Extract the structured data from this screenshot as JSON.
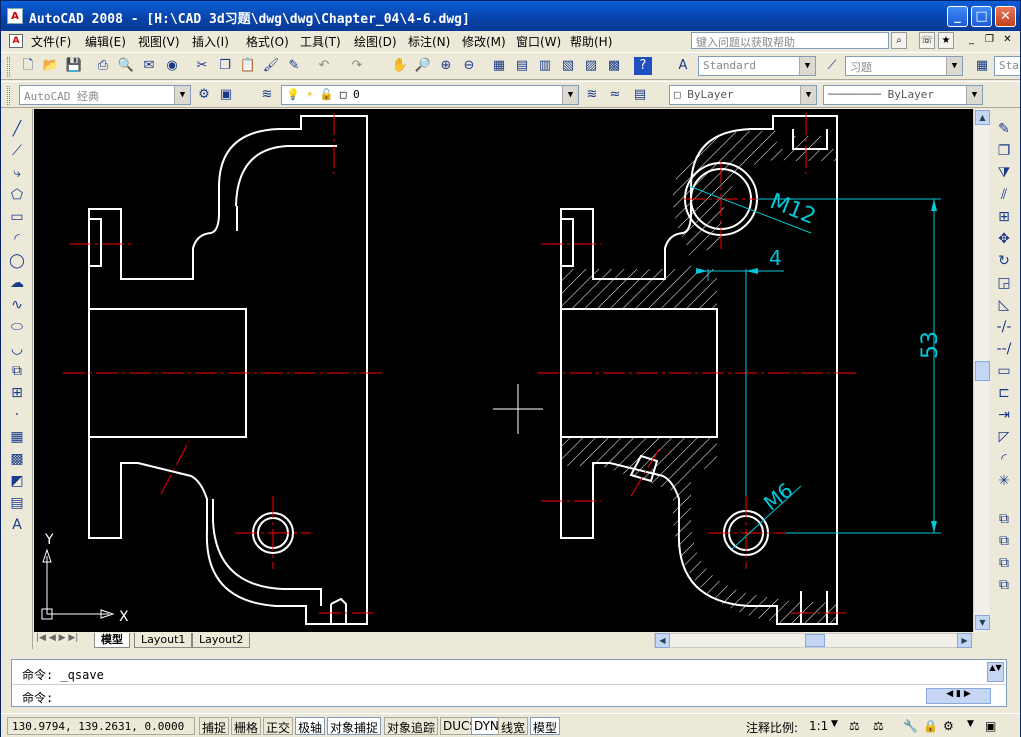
{
  "window": {
    "title": "AutoCAD 2008 - [H:\\CAD  3d习题\\dwg\\dwg\\Chapter_04\\4-6.dwg]",
    "app_icon": "A",
    "minimize_icon": "minimize-icon",
    "maximize_icon": "maximize-icon",
    "close_icon": "close-icon"
  },
  "menu": {
    "items": [
      "文件(F)",
      "编辑(E)",
      "视图(V)",
      "插入(I)",
      "格式(O)",
      "工具(T)",
      "绘图(D)",
      "标注(N)",
      "修改(M)",
      "窗口(W)",
      "帮助(H)"
    ],
    "help_placeholder": "键入问题以获取帮助"
  },
  "toolbar1": {
    "text_style": "Standard",
    "dim_style": "习题",
    "table_style_partial": "Sta"
  },
  "toolbar2": {
    "workspace": "AutoCAD 经典",
    "layer": "0",
    "color": "ByLayer",
    "linetype": "ByLayer"
  },
  "drawing": {
    "dimensions": {
      "m12": "M12",
      "four": "4",
      "fifty_three": "53",
      "m6": "M6"
    },
    "ucs": {
      "x_label": "X",
      "y_label": "Y"
    },
    "colors": {
      "outline": "#ffffff",
      "center": "#ff0000",
      "dimension": "#00c8d8",
      "background": "#000000"
    }
  },
  "tabs": [
    "模型",
    "Layout1",
    "Layout2"
  ],
  "command": {
    "line1": "命令: _qsave",
    "line2": "命令:"
  },
  "status": {
    "coordinates": "130.9794, 139.2631, 0.0000",
    "toggles": [
      "捕捉",
      "栅格",
      "正交",
      "极轴",
      "对象捕捉",
      "对象追踪",
      "DUCS",
      "DYN",
      "线宽",
      "模型"
    ],
    "annotation_scale_label": "注释比例:",
    "annotation_scale_value": "1:1"
  }
}
